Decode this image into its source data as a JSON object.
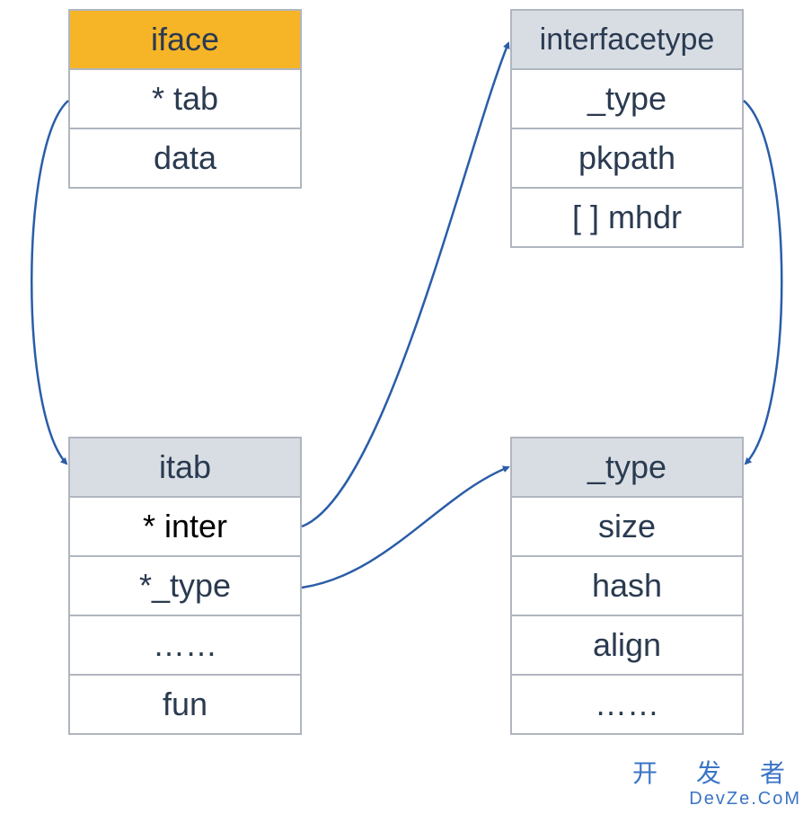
{
  "iface": {
    "header": "iface",
    "fields": [
      "* tab",
      "data"
    ]
  },
  "interfacetype": {
    "header": "interfacetype",
    "fields": [
      "_type",
      "pkpath",
      "[ ] mhdr"
    ]
  },
  "itab": {
    "header": "itab",
    "fields": [
      "* inter",
      "*_type",
      "……",
      "fun"
    ]
  },
  "type": {
    "header": "_type",
    "fields": [
      "size",
      "hash",
      "align",
      "……"
    ]
  },
  "watermark": {
    "line1": "开 发 者",
    "line2": "DevZe.CoM"
  }
}
